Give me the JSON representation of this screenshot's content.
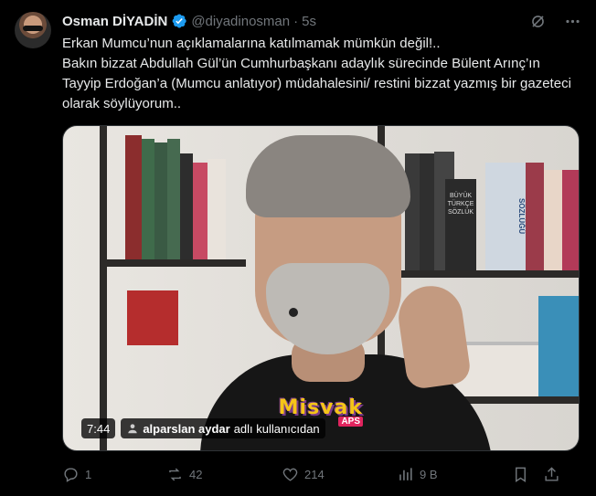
{
  "author": {
    "name": "Osman DİYADİN",
    "handle": "@diyadinosman",
    "separator": "·",
    "time": "5s"
  },
  "tweet": {
    "text": "Erkan Mumcu’nun açıklamalarına katılmamak mümkün değil!..\nBakın bizzat Abdullah Gül’ün Cumhurbaşkanı adaylık sürecinde Bülent Arınç’ın  Tayyip Erdoğan’a (Mumcu anlatıyor) müdahalesini/ restini bizzat yazmış bir gazeteci olarak söylüyorum.."
  },
  "media": {
    "duration": "7:44",
    "credit_user": "alparslan aydar",
    "credit_suffix": "adlı kullanıcıdan",
    "watermark": "Misvak",
    "watermark_sub": "APS",
    "books": {
      "spine_1": "BÜYÜK TÜRKÇE SÖZLÜK",
      "spine_2": "SÖZLÜĞÜ"
    }
  },
  "actions": {
    "replies": "1",
    "reposts": "42",
    "likes": "214",
    "views": "9 B"
  },
  "icons": {
    "verified": "verified-badge-icon",
    "grok": "grok-icon",
    "more": "more-icon",
    "reply": "reply-icon",
    "repost": "repost-icon",
    "like": "heart-icon",
    "views": "views-icon",
    "bookmark": "bookmark-icon",
    "share": "share-icon"
  },
  "colors": {
    "background": "#000000",
    "text": "#e7e9ea",
    "muted": "#71767b",
    "verified": "#1d9bf0"
  }
}
